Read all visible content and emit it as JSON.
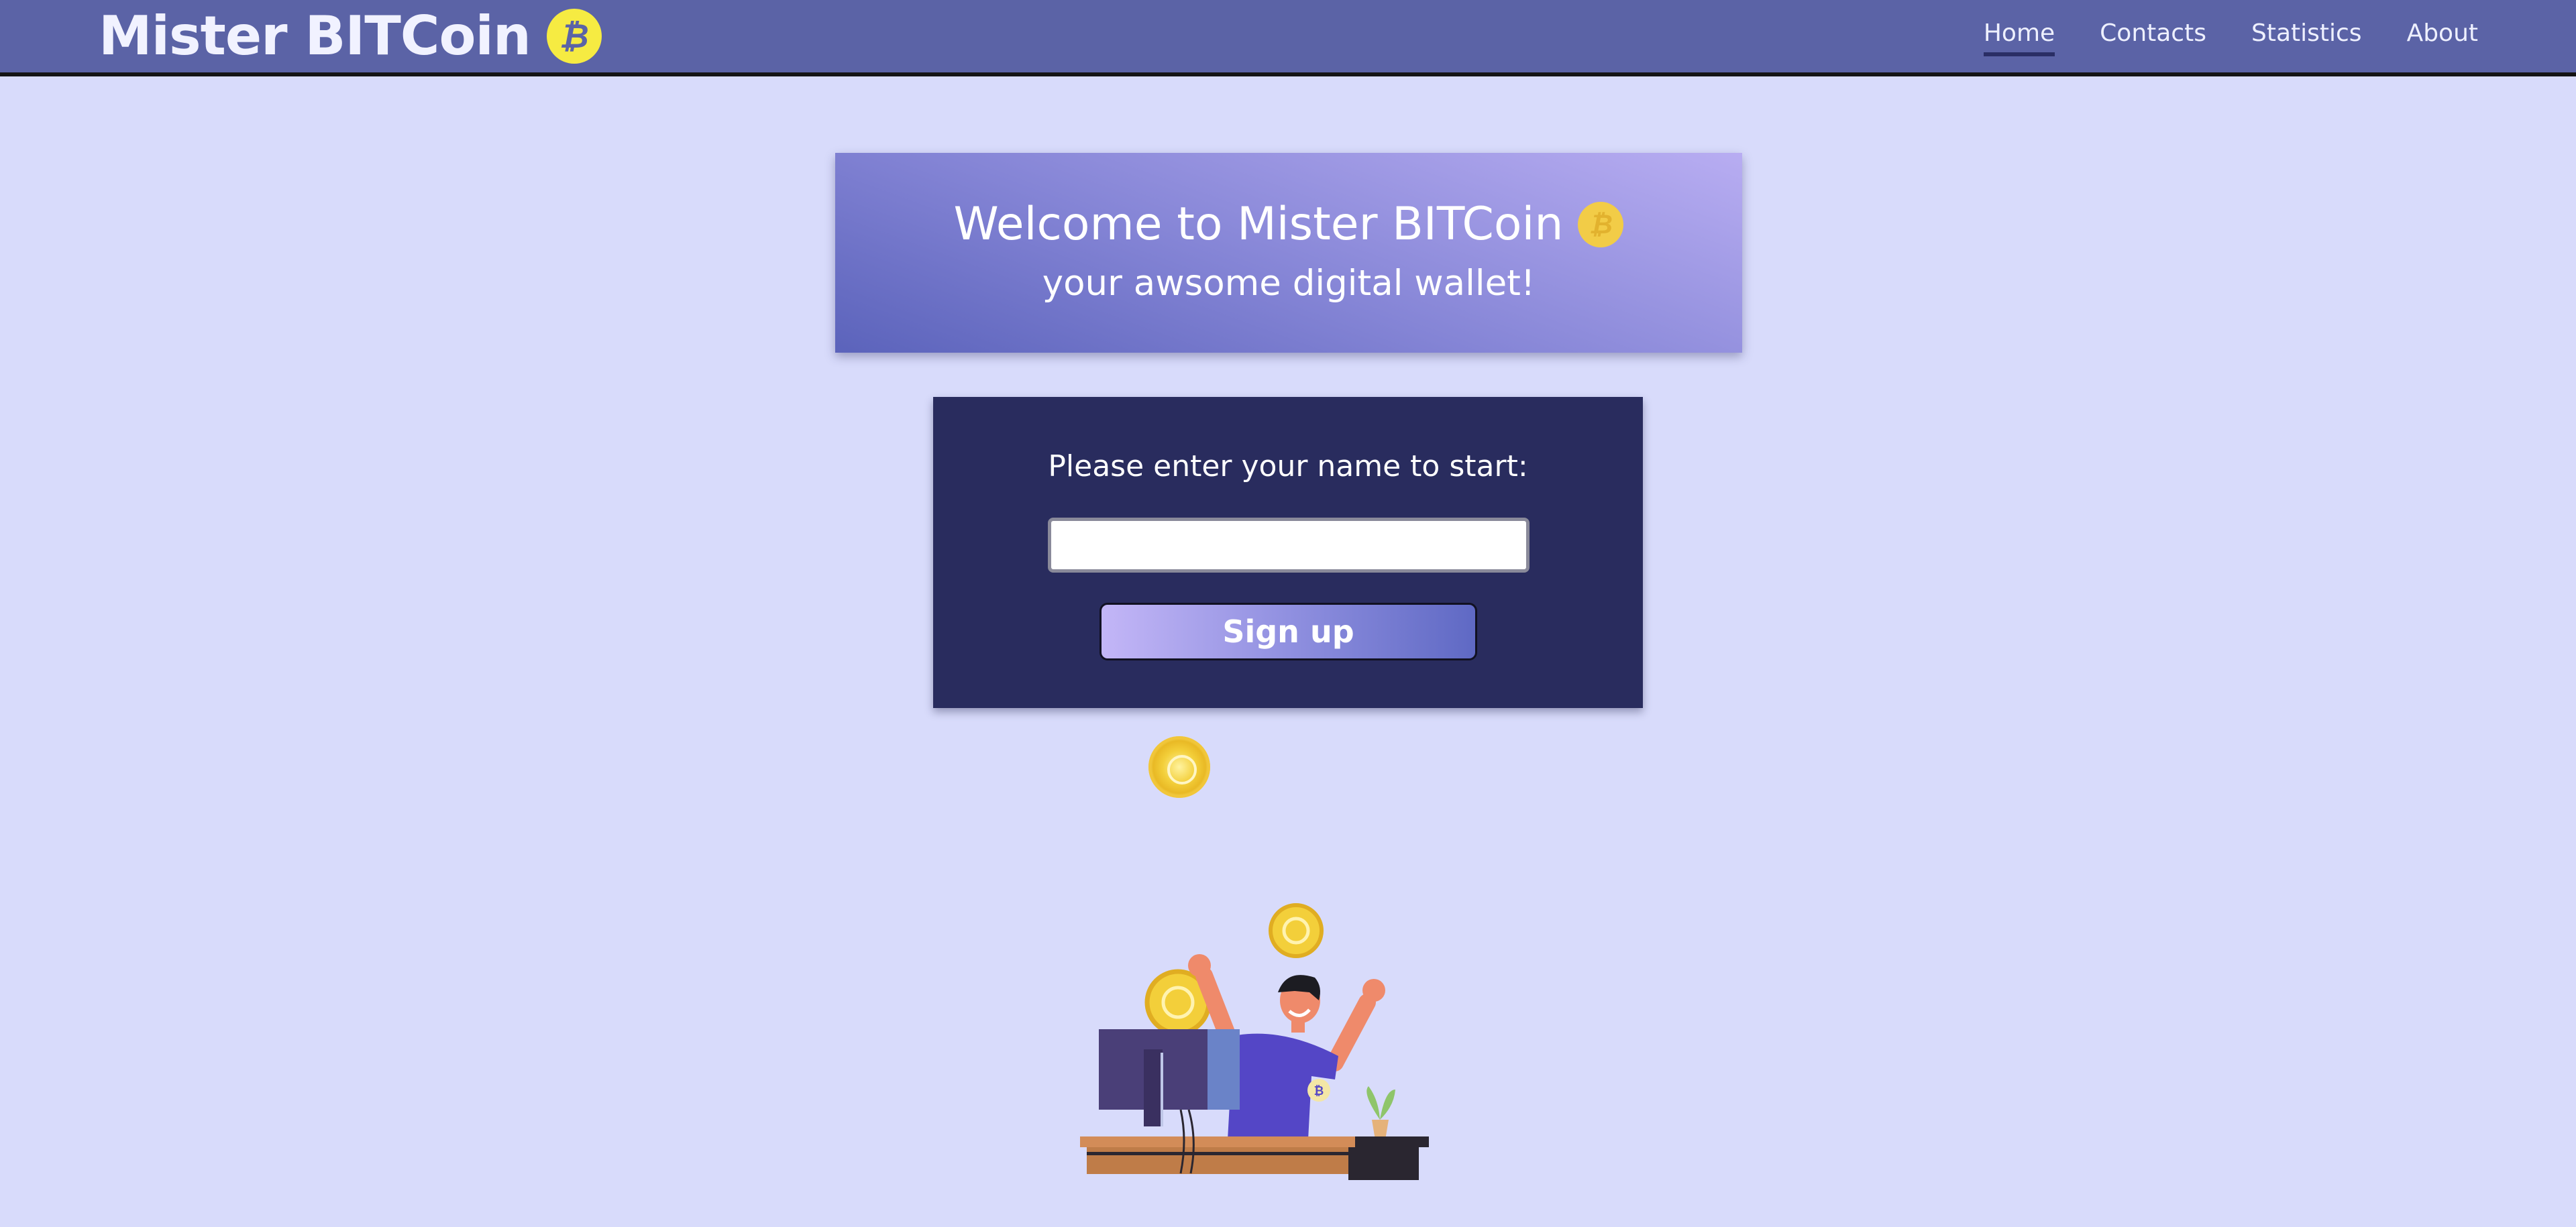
{
  "header": {
    "brand_title": "Mister BITCoin",
    "brand_icon": "bitcoin-coin-icon",
    "nav": [
      {
        "label": "Home",
        "active": true
      },
      {
        "label": "Contacts",
        "active": false
      },
      {
        "label": "Statistics",
        "active": false
      },
      {
        "label": "About",
        "active": false
      }
    ]
  },
  "welcome": {
    "title": "Welcome to Mister BITCoin",
    "subtitle": "your awsome digital wallet!",
    "icon": "bitcoin-coin-icon"
  },
  "signup": {
    "prompt": "Please enter your name to start:",
    "name_value": "",
    "button_label": "Sign up"
  },
  "colors": {
    "background": "#d8dbfb",
    "header": "#5b63a6",
    "card_dark": "#292c5e",
    "coin_yellow": "#f6eb42"
  },
  "illustration": {
    "icon": "happy-man-at-computer-illustration"
  }
}
